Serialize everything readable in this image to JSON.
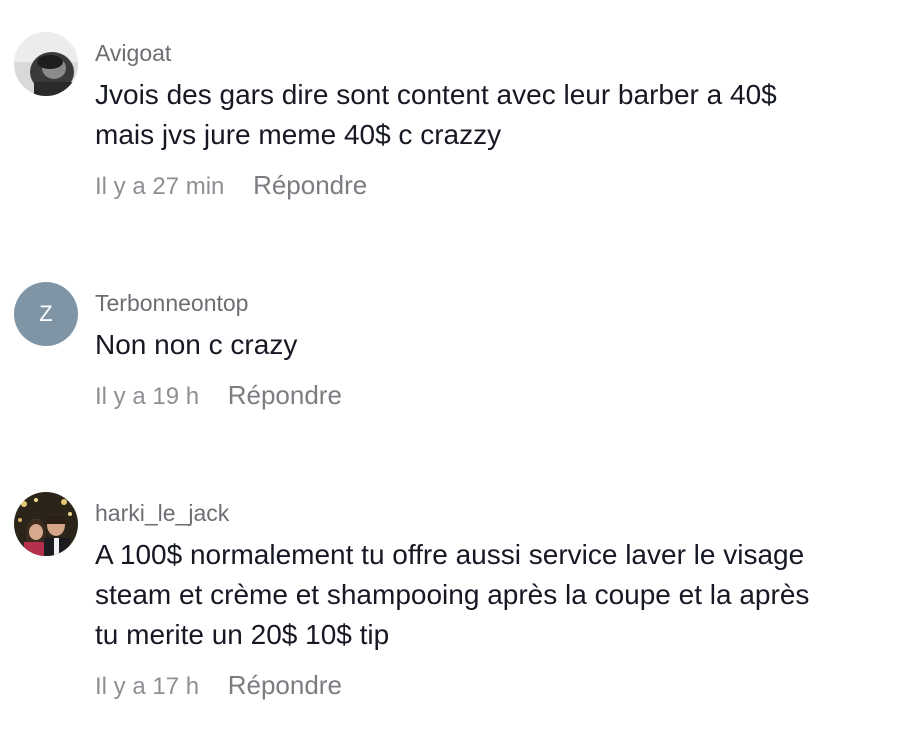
{
  "comments": [
    {
      "username": "Avigoat",
      "avatar": "photo-avatar-grayscale",
      "text_lines": [
        "Jvois des gars dire sont content avec leur barber a 40$",
        "mais jvs jure meme 40$ c crazzy"
      ],
      "time": "Il y a 27 min",
      "reply_label": "Répondre"
    },
    {
      "username": "Terbonneontop",
      "avatar_letter": "Z",
      "avatar_color": "#7f95a6",
      "text_lines": [
        "Non non c crazy"
      ],
      "time": "Il y a 19 h",
      "reply_label": "Répondre"
    },
    {
      "username": "harki_le_jack",
      "avatar": "photo-avatar-couple",
      "text_lines": [
        "A 100$ normalement tu offre aussi service laver le visage",
        "steam et crème et shampooing après la coupe et la après",
        "tu merite un 20$ 10$ tip"
      ],
      "time": "Il y a 17 h",
      "reply_label": "Répondre"
    }
  ]
}
